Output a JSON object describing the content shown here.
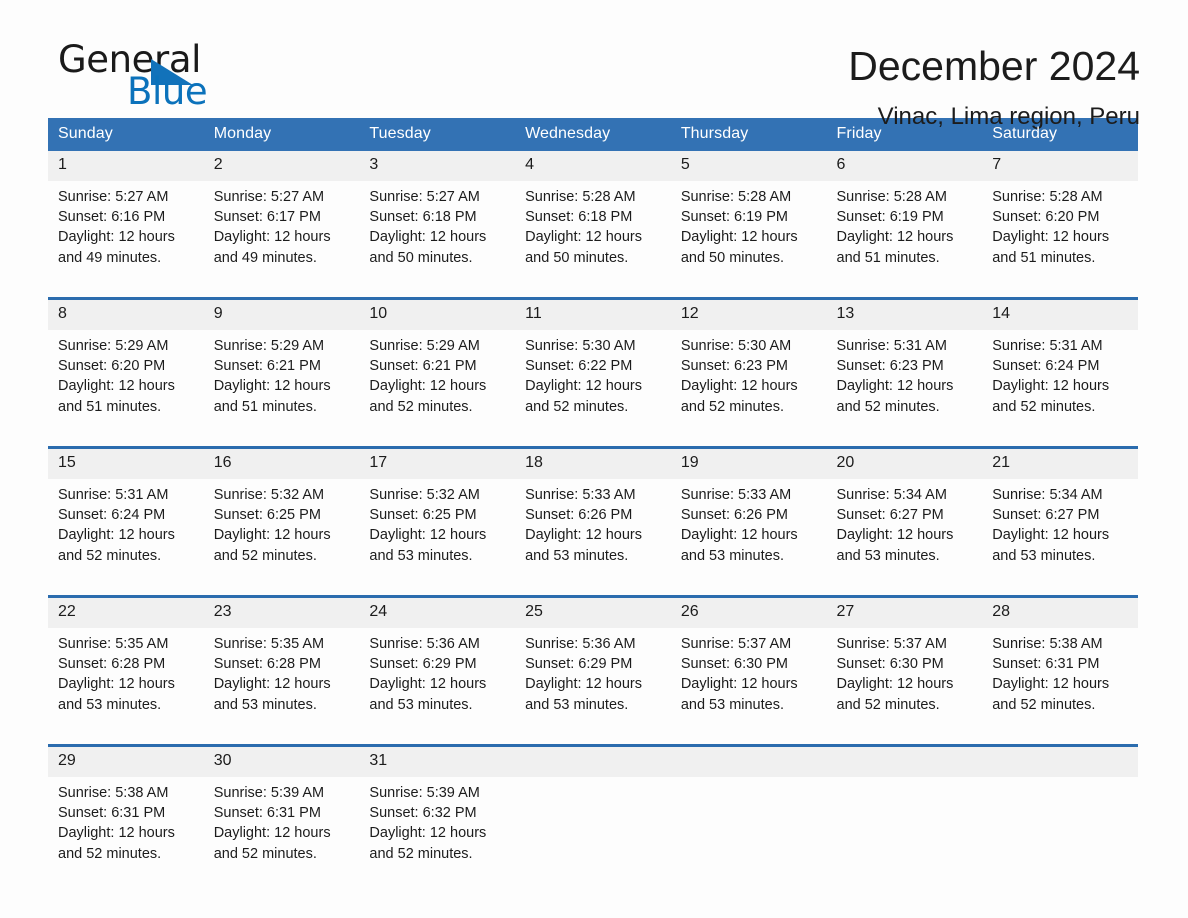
{
  "brand": {
    "name_part1": "General",
    "name_part2": "Blue",
    "accent_color": "#0b72bb"
  },
  "header": {
    "month_title": "December 2024",
    "location": "Vinac, Lima region, Peru"
  },
  "theme": {
    "header_bar_color": "#3372b4",
    "week_rule_color": "#2b6cae",
    "daynum_strip_color": "#f0f0f0",
    "page_background": "#fdfdfd",
    "text_color": "#1c1c1c"
  },
  "calendar": {
    "weekday_headers": [
      "Sunday",
      "Monday",
      "Tuesday",
      "Wednesday",
      "Thursday",
      "Friday",
      "Saturday"
    ],
    "weeks": [
      [
        {
          "day": "1",
          "sunrise": "Sunrise: 5:27 AM",
          "sunset": "Sunset: 6:16 PM",
          "daylight": "Daylight: 12 hours and 49 minutes."
        },
        {
          "day": "2",
          "sunrise": "Sunrise: 5:27 AM",
          "sunset": "Sunset: 6:17 PM",
          "daylight": "Daylight: 12 hours and 49 minutes."
        },
        {
          "day": "3",
          "sunrise": "Sunrise: 5:27 AM",
          "sunset": "Sunset: 6:18 PM",
          "daylight": "Daylight: 12 hours and 50 minutes."
        },
        {
          "day": "4",
          "sunrise": "Sunrise: 5:28 AM",
          "sunset": "Sunset: 6:18 PM",
          "daylight": "Daylight: 12 hours and 50 minutes."
        },
        {
          "day": "5",
          "sunrise": "Sunrise: 5:28 AM",
          "sunset": "Sunset: 6:19 PM",
          "daylight": "Daylight: 12 hours and 50 minutes."
        },
        {
          "day": "6",
          "sunrise": "Sunrise: 5:28 AM",
          "sunset": "Sunset: 6:19 PM",
          "daylight": "Daylight: 12 hours and 51 minutes."
        },
        {
          "day": "7",
          "sunrise": "Sunrise: 5:28 AM",
          "sunset": "Sunset: 6:20 PM",
          "daylight": "Daylight: 12 hours and 51 minutes."
        }
      ],
      [
        {
          "day": "8",
          "sunrise": "Sunrise: 5:29 AM",
          "sunset": "Sunset: 6:20 PM",
          "daylight": "Daylight: 12 hours and 51 minutes."
        },
        {
          "day": "9",
          "sunrise": "Sunrise: 5:29 AM",
          "sunset": "Sunset: 6:21 PM",
          "daylight": "Daylight: 12 hours and 51 minutes."
        },
        {
          "day": "10",
          "sunrise": "Sunrise: 5:29 AM",
          "sunset": "Sunset: 6:21 PM",
          "daylight": "Daylight: 12 hours and 52 minutes."
        },
        {
          "day": "11",
          "sunrise": "Sunrise: 5:30 AM",
          "sunset": "Sunset: 6:22 PM",
          "daylight": "Daylight: 12 hours and 52 minutes."
        },
        {
          "day": "12",
          "sunrise": "Sunrise: 5:30 AM",
          "sunset": "Sunset: 6:23 PM",
          "daylight": "Daylight: 12 hours and 52 minutes."
        },
        {
          "day": "13",
          "sunrise": "Sunrise: 5:31 AM",
          "sunset": "Sunset: 6:23 PM",
          "daylight": "Daylight: 12 hours and 52 minutes."
        },
        {
          "day": "14",
          "sunrise": "Sunrise: 5:31 AM",
          "sunset": "Sunset: 6:24 PM",
          "daylight": "Daylight: 12 hours and 52 minutes."
        }
      ],
      [
        {
          "day": "15",
          "sunrise": "Sunrise: 5:31 AM",
          "sunset": "Sunset: 6:24 PM",
          "daylight": "Daylight: 12 hours and 52 minutes."
        },
        {
          "day": "16",
          "sunrise": "Sunrise: 5:32 AM",
          "sunset": "Sunset: 6:25 PM",
          "daylight": "Daylight: 12 hours and 52 minutes."
        },
        {
          "day": "17",
          "sunrise": "Sunrise: 5:32 AM",
          "sunset": "Sunset: 6:25 PM",
          "daylight": "Daylight: 12 hours and 53 minutes."
        },
        {
          "day": "18",
          "sunrise": "Sunrise: 5:33 AM",
          "sunset": "Sunset: 6:26 PM",
          "daylight": "Daylight: 12 hours and 53 minutes."
        },
        {
          "day": "19",
          "sunrise": "Sunrise: 5:33 AM",
          "sunset": "Sunset: 6:26 PM",
          "daylight": "Daylight: 12 hours and 53 minutes."
        },
        {
          "day": "20",
          "sunrise": "Sunrise: 5:34 AM",
          "sunset": "Sunset: 6:27 PM",
          "daylight": "Daylight: 12 hours and 53 minutes."
        },
        {
          "day": "21",
          "sunrise": "Sunrise: 5:34 AM",
          "sunset": "Sunset: 6:27 PM",
          "daylight": "Daylight: 12 hours and 53 minutes."
        }
      ],
      [
        {
          "day": "22",
          "sunrise": "Sunrise: 5:35 AM",
          "sunset": "Sunset: 6:28 PM",
          "daylight": "Daylight: 12 hours and 53 minutes."
        },
        {
          "day": "23",
          "sunrise": "Sunrise: 5:35 AM",
          "sunset": "Sunset: 6:28 PM",
          "daylight": "Daylight: 12 hours and 53 minutes."
        },
        {
          "day": "24",
          "sunrise": "Sunrise: 5:36 AM",
          "sunset": "Sunset: 6:29 PM",
          "daylight": "Daylight: 12 hours and 53 minutes."
        },
        {
          "day": "25",
          "sunrise": "Sunrise: 5:36 AM",
          "sunset": "Sunset: 6:29 PM",
          "daylight": "Daylight: 12 hours and 53 minutes."
        },
        {
          "day": "26",
          "sunrise": "Sunrise: 5:37 AM",
          "sunset": "Sunset: 6:30 PM",
          "daylight": "Daylight: 12 hours and 53 minutes."
        },
        {
          "day": "27",
          "sunrise": "Sunrise: 5:37 AM",
          "sunset": "Sunset: 6:30 PM",
          "daylight": "Daylight: 12 hours and 52 minutes."
        },
        {
          "day": "28",
          "sunrise": "Sunrise: 5:38 AM",
          "sunset": "Sunset: 6:31 PM",
          "daylight": "Daylight: 12 hours and 52 minutes."
        }
      ],
      [
        {
          "day": "29",
          "sunrise": "Sunrise: 5:38 AM",
          "sunset": "Sunset: 6:31 PM",
          "daylight": "Daylight: 12 hours and 52 minutes."
        },
        {
          "day": "30",
          "sunrise": "Sunrise: 5:39 AM",
          "sunset": "Sunset: 6:31 PM",
          "daylight": "Daylight: 12 hours and 52 minutes."
        },
        {
          "day": "31",
          "sunrise": "Sunrise: 5:39 AM",
          "sunset": "Sunset: 6:32 PM",
          "daylight": "Daylight: 12 hours and 52 minutes."
        },
        {
          "day": "",
          "sunrise": "",
          "sunset": "",
          "daylight": ""
        },
        {
          "day": "",
          "sunrise": "",
          "sunset": "",
          "daylight": ""
        },
        {
          "day": "",
          "sunrise": "",
          "sunset": "",
          "daylight": ""
        },
        {
          "day": "",
          "sunrise": "",
          "sunset": "",
          "daylight": ""
        }
      ]
    ]
  }
}
